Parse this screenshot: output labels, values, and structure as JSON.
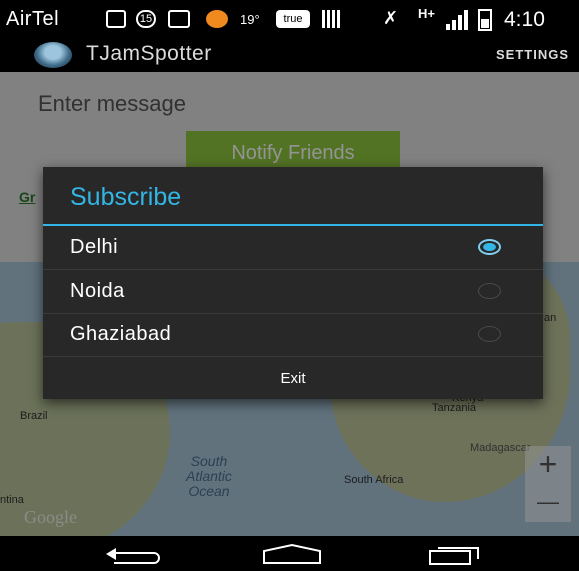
{
  "status_bar": {
    "carrier": "AirTel",
    "badge_count": "15",
    "temperature": "19°",
    "true_badge": "true",
    "network": "H+",
    "time": "4:10"
  },
  "action_bar": {
    "title": "TJamSpotter",
    "settings_label": "SETTINGS"
  },
  "form": {
    "message_placeholder": "Enter message",
    "notify_label": "Notify Friends",
    "partial_link": "Gr"
  },
  "map": {
    "labels": [
      "Brazil",
      "Tanzania",
      "Madagascar",
      "South Africa",
      "ntina",
      "Kenya",
      "an"
    ],
    "ocean_label": "South\nAtlantic\nOcean",
    "google_logo": "Google",
    "zoom_in": "+",
    "zoom_out": "—"
  },
  "dialog": {
    "title": "Subscribe",
    "options": [
      {
        "label": "Delhi",
        "checked": true
      },
      {
        "label": "Noida",
        "checked": false
      },
      {
        "label": "Ghaziabad",
        "checked": false
      }
    ],
    "exit_label": "Exit"
  },
  "colors": {
    "accent": "#33b5e5",
    "notify_button": "#8ec63f",
    "dialog_bg": "#282828"
  },
  "icons": {
    "nav_back": "back-icon",
    "nav_home": "home-icon",
    "nav_recent": "recent-apps-icon"
  }
}
